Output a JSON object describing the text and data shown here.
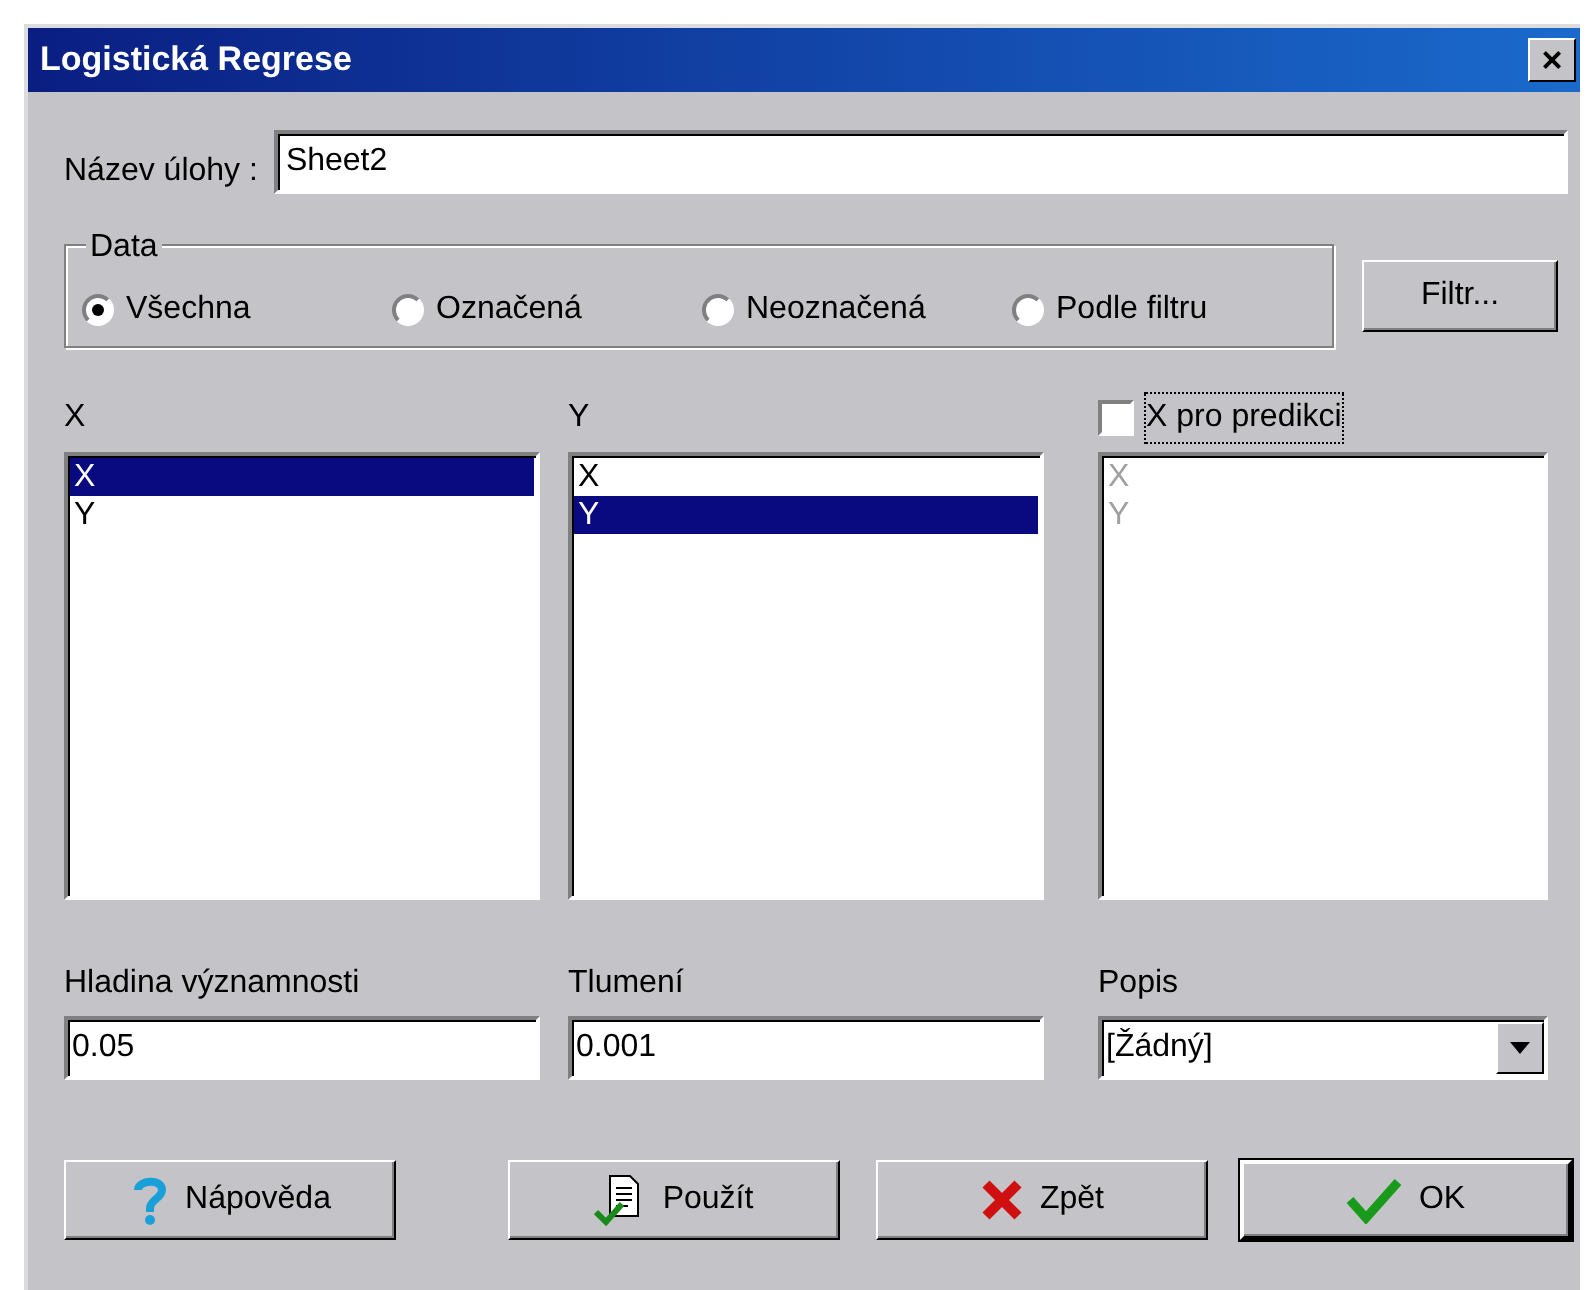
{
  "window": {
    "title": "Logistická Regrese",
    "close": "×"
  },
  "task_name": {
    "label": "Název úlohy :",
    "value": "Sheet2"
  },
  "data_group": {
    "title": "Data",
    "options": [
      {
        "label": "Všechna",
        "selected": true
      },
      {
        "label": "Označená",
        "selected": false
      },
      {
        "label": "Neoznačená",
        "selected": false
      },
      {
        "label": "Podle filtru",
        "selected": false
      }
    ]
  },
  "filter_button": {
    "label": "Filtr..."
  },
  "lists": [
    {
      "kind": "label",
      "label": "X",
      "disabled": false,
      "items": [
        {
          "text": "X",
          "selected": true
        },
        {
          "text": "Y",
          "selected": false
        }
      ]
    },
    {
      "kind": "label",
      "label": "Y",
      "disabled": false,
      "items": [
        {
          "text": "X",
          "selected": false
        },
        {
          "text": "Y",
          "selected": true
        }
      ]
    },
    {
      "kind": "checkbox",
      "label": "X pro predikci",
      "checked": false,
      "focused": true,
      "disabled": true,
      "items": [
        {
          "text": "X",
          "selected": false
        },
        {
          "text": "Y",
          "selected": false
        }
      ]
    }
  ],
  "fields": [
    {
      "kind": "text",
      "label": "Hladina významnosti",
      "value": "0.05"
    },
    {
      "kind": "text",
      "label": "Tlumení",
      "value": "0.001"
    },
    {
      "kind": "combo",
      "label": "Popis",
      "value": "[Žádný]"
    }
  ],
  "buttons": [
    {
      "kind": "help",
      "label": "Nápověda",
      "default": false
    },
    {
      "kind": "apply",
      "label": "Použít",
      "default": false
    },
    {
      "kind": "cancel",
      "label": "Zpět",
      "default": false
    },
    {
      "kind": "ok",
      "label": "OK",
      "default": true
    }
  ]
}
